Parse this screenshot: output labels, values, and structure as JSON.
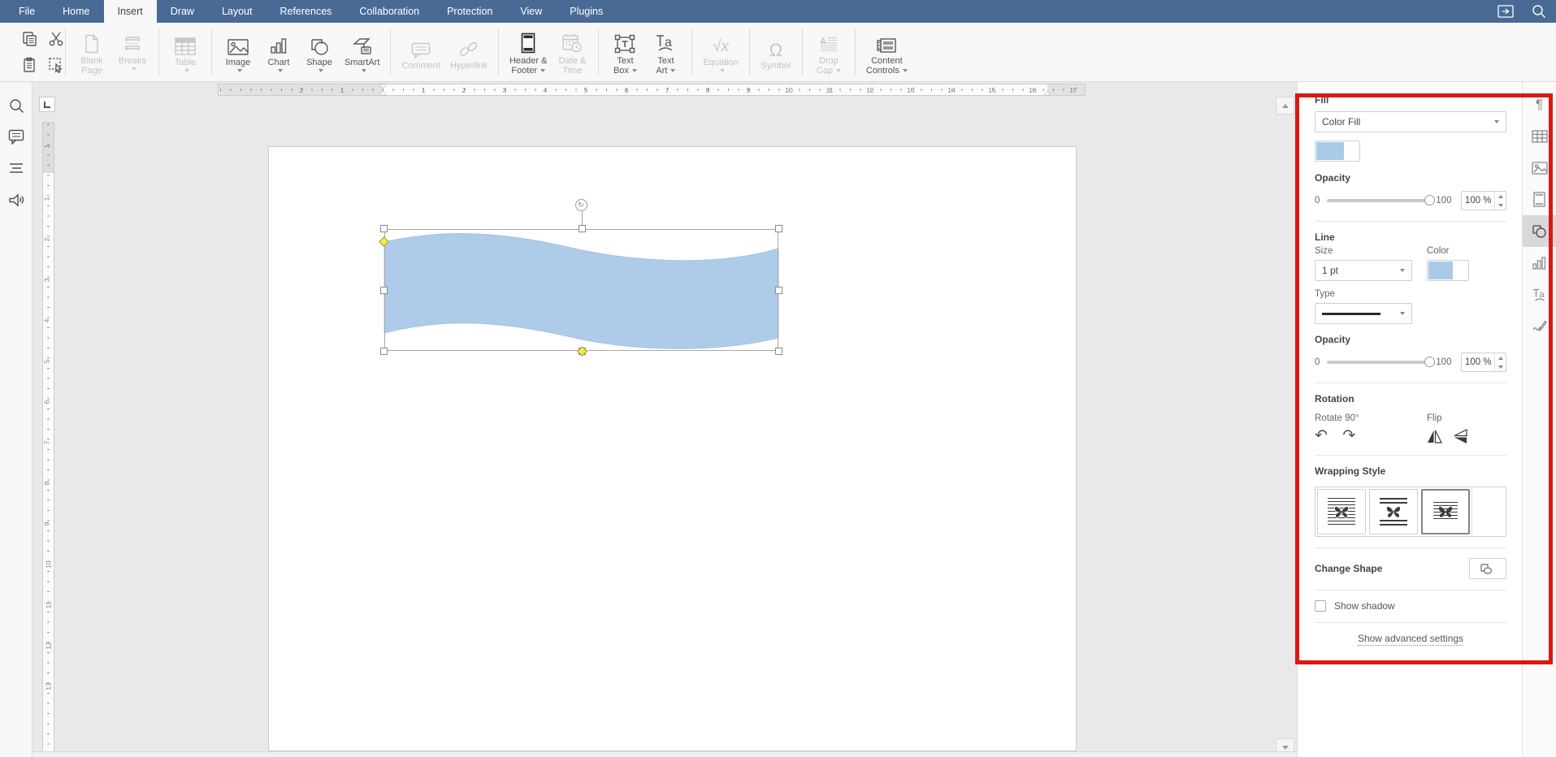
{
  "menu": {
    "tabs": [
      {
        "label": "File",
        "active": false
      },
      {
        "label": "Home",
        "active": false
      },
      {
        "label": "Insert",
        "active": true
      },
      {
        "label": "Draw",
        "active": false
      },
      {
        "label": "Layout",
        "active": false
      },
      {
        "label": "References",
        "active": false
      },
      {
        "label": "Collaboration",
        "active": false
      },
      {
        "label": "Protection",
        "active": false
      },
      {
        "label": "View",
        "active": false
      },
      {
        "label": "Plugins",
        "active": false
      }
    ],
    "right_icons": [
      "open-file-location-icon",
      "search-icon"
    ]
  },
  "toolbar": {
    "buttons": [
      {
        "icon": "copy-icon",
        "label1": "",
        "label2": "",
        "enabled": true,
        "chevron": false
      },
      {
        "icon": "cut-icon",
        "label1": "",
        "label2": "",
        "enabled": true,
        "chevron": false
      },
      {
        "icon": "paste-icon",
        "label1": "",
        "label2": "",
        "enabled": true,
        "chevron": false
      },
      {
        "icon": "select-icon",
        "label1": "",
        "label2": "",
        "enabled": true,
        "chevron": false
      },
      {
        "icon": "blank-page-icon",
        "label1": "Blank",
        "label2": "Page",
        "enabled": false,
        "chevron": false
      },
      {
        "icon": "breaks-icon",
        "label1": "Breaks",
        "label2": "",
        "enabled": false,
        "chevron": true
      },
      {
        "icon": "table-icon",
        "label1": "Table",
        "label2": "",
        "enabled": false,
        "chevron": true
      },
      {
        "icon": "image-icon",
        "label1": "Image",
        "label2": "",
        "enabled": true,
        "chevron": true
      },
      {
        "icon": "chart-icon",
        "label1": "Chart",
        "label2": "",
        "enabled": true,
        "chevron": true
      },
      {
        "icon": "shape-icon",
        "label1": "Shape",
        "label2": "",
        "enabled": true,
        "chevron": true
      },
      {
        "icon": "smartart-icon",
        "label1": "SmartArt",
        "label2": "",
        "enabled": true,
        "chevron": true
      },
      {
        "icon": "comment-icon",
        "label1": "Comment",
        "label2": "",
        "enabled": false,
        "chevron": false
      },
      {
        "icon": "hyperlink-icon",
        "label1": "Hyperlink",
        "label2": "",
        "enabled": false,
        "chevron": false
      },
      {
        "icon": "header-footer-icon",
        "label1": "Header &",
        "label2": "Footer",
        "enabled": true,
        "chevron": true
      },
      {
        "icon": "date-time-icon",
        "label1": "Date &",
        "label2": "Time",
        "enabled": false,
        "chevron": false
      },
      {
        "icon": "text-box-icon",
        "label1": "Text",
        "label2": "Box",
        "enabled": true,
        "chevron": true
      },
      {
        "icon": "text-art-icon",
        "label1": "Text",
        "label2": "Art",
        "enabled": true,
        "chevron": true
      },
      {
        "icon": "equation-icon",
        "label1": "Equation",
        "label2": "",
        "enabled": false,
        "chevron": true
      },
      {
        "icon": "symbol-icon",
        "label1": "Symbol",
        "label2": "",
        "enabled": false,
        "chevron": false
      },
      {
        "icon": "drop-cap-icon",
        "label1": "Drop",
        "label2": "Cap",
        "enabled": false,
        "chevron": true
      },
      {
        "icon": "content-controls-icon",
        "label1": "Content",
        "label2": "Controls",
        "enabled": true,
        "chevron": true
      }
    ]
  },
  "sidebar": {
    "icons": [
      "search-icon",
      "comments-icon",
      "navigation-icon",
      "feedback-icon"
    ]
  },
  "ruler": {
    "h_margin_numbers": [
      "2",
      "1"
    ],
    "h_numbers": [
      "1",
      "2",
      "3",
      "4",
      "5",
      "6",
      "7",
      "8",
      "9",
      "10",
      "11",
      "12",
      "13",
      "14",
      "15",
      "16",
      "17"
    ],
    "v_margin_numbers": [
      "1"
    ],
    "v_numbers": [
      "1",
      "2",
      "3",
      "4",
      "5",
      "6",
      "7",
      "8",
      "9",
      "10",
      "11",
      "12",
      "13"
    ]
  },
  "document": {
    "shape": {
      "type": "wave",
      "fill_color": "#aecbe9",
      "selected": true
    }
  },
  "panel": {
    "fill": {
      "title": "Fill",
      "type_value": "Color Fill",
      "color_swatch": "#a9cbe8",
      "opacity_label": "Opacity",
      "opacity_min": "0",
      "opacity_max": "100",
      "opacity_value": "100 %"
    },
    "line": {
      "title": "Line",
      "size_label": "Size",
      "size_value": "1 pt",
      "color_label": "Color",
      "color_swatch": "#a9cbe8",
      "type_label": "Type",
      "opacity_label": "Opacity",
      "opacity_min": "0",
      "opacity_max": "100",
      "opacity_value": "100 %"
    },
    "rotation": {
      "title": "Rotation",
      "rotate_label": "Rotate 90°",
      "flip_label": "Flip"
    },
    "wrapping": {
      "title": "Wrapping Style",
      "options": [
        "square",
        "top-and-bottom",
        "in-front-of-text"
      ],
      "selected": "in-front-of-text"
    },
    "change_shape_label": "Change Shape",
    "show_shadow_label": "Show shadow",
    "show_shadow_checked": false,
    "advanced_link": "Show advanced settings"
  },
  "right_rail": {
    "icons": [
      "paragraph-settings",
      "table-settings",
      "image-settings",
      "header-footer-settings",
      "shape-settings",
      "chart-settings",
      "text-art-settings",
      "signature-settings"
    ],
    "active": "shape-settings"
  },
  "annotation": {
    "color": "#dd1712"
  },
  "colors": {
    "header": "#4a6a96",
    "accent_blue": "#a9cbe8",
    "wave_fill": "#aecbe9"
  }
}
